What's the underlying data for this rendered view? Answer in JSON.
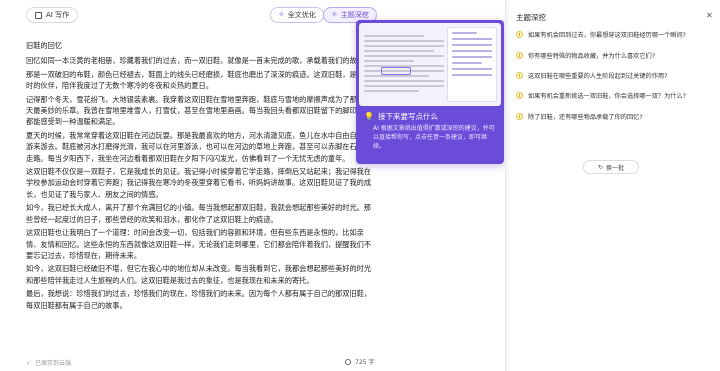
{
  "toolbar": {
    "ai_write_label": "AI 写作",
    "polish_all_label": "全文优化",
    "deep_explore_label": "主题深挖"
  },
  "document": {
    "title": "旧鞋的回忆",
    "paragraphs": [
      "回忆如同一本泛黄的老相册，珍藏着我们的过去，而一双旧鞋，就像是一首未完成的歌，承载着我们的故事。",
      "那是一双破旧的布鞋，颜色已经褪去，鞋面上的线头已经磨损，鞋底也磨出了深深的痕迹。这双旧鞋，是我儿时的伙伴，陪伴我度过了无数个寒冷的冬夜和炎热的夏日。",
      "记得那个冬天，雪花纷飞，大地银装素裹。我穿着这双旧鞋在雪地里奔跑，鞋底与雪地的摩擦声成为了那个冬天最美妙的乐章。我曾在雪地里堆雪人，打雪仗，甚至在雪地里画画。每当我回头看都双旧鞋留下的脚印，我都能感受到一种温暖和满足。",
      "夏天的时候，我常常穿着这双旧鞋在河边玩耍。那是我最喜欢的地方，河水清澈见底，鱼儿在水中自由自在地游来游去。鞋底被河水打磨得光滑，我可以在河里游泳，也可以在河边的草地上奔跑，甚至可以赤脚在石头上走路。每当夕阳西下，我坐在河边看着那双旧鞋在夕阳下闪闪发光，仿佛看到了一个无忧无虑的童年。",
      "这双旧鞋不仅仅是一双鞋子，它是我成长的见证。我记得小时候穿着它学走路，摔倒后又站起来；我记得我在学校参加运动会时穿着它奔跑；我记得我在寒冷的冬夜里穿着它看书，听妈妈讲故事。这双旧鞋见证了我的成长，也见证了我与家人、朋友之间的情感。",
      "如今，我已经长大成人，离开了那个充满回忆的小镇。每当我想起那双旧鞋，我就会想起那些美好的时光。那些曾经一起度过的日子，那些曾经的欢笑和泪水，都化作了这双旧鞋上的痕迹。",
      "这双旧鞋也让我明白了一个道理：时间会改变一切，包括我们的容颜和环境，但有些东西是永恒的，比如亲情、友情和回忆。这些永恒的东西就像这双旧鞋一样，无论我们走到哪里，它们都会陪伴着我们，提醒我们不要忘记过去，珍惜现在，期待未来。",
      "如今，这双旧鞋已经破旧不堪，但它在我心中的地位却从未改变。每当我看到它，我都会想起那些美好的时光和那些陪伴我走过人生旅程的人们。这双旧鞋是我过去的象征，也是我现在和未来的寄托。",
      "最后，我想说：珍惜我们的过去，珍惜我们的现在，珍惜我们的未来。因为每个人都有属于自己的那双旧鞋，每双旧鞋都有属于自己的故事。"
    ]
  },
  "footer": {
    "saved_label": "已保存到云端",
    "word_count": "725 字"
  },
  "tip_popup": {
    "title": "接下来要写点什么",
    "description": "AI 根据文章挑出值得扩散或深挖的建议，并可以直接帮你写，点击任意一条建议，即可继续。"
  },
  "side_panel": {
    "title": "主题深挖",
    "questions": [
      "如果有机会回到过去，你最想穿这双旧鞋经历哪一个瞬间?",
      "你有哪些特殊的物品收藏，并为什么喜欢它们?",
      "这双旧鞋在哪些重要的人生阶段起到过关键的作用?",
      "如果有机会重新挑选一双旧鞋，你会选择哪一双？为什么?",
      "除了旧鞋，还有哪些物品承载了你的回忆?"
    ],
    "refresh_label": "换一批"
  },
  "colors": {
    "accent": "#6a4cd8",
    "accent_light": "#f4f0ff"
  }
}
